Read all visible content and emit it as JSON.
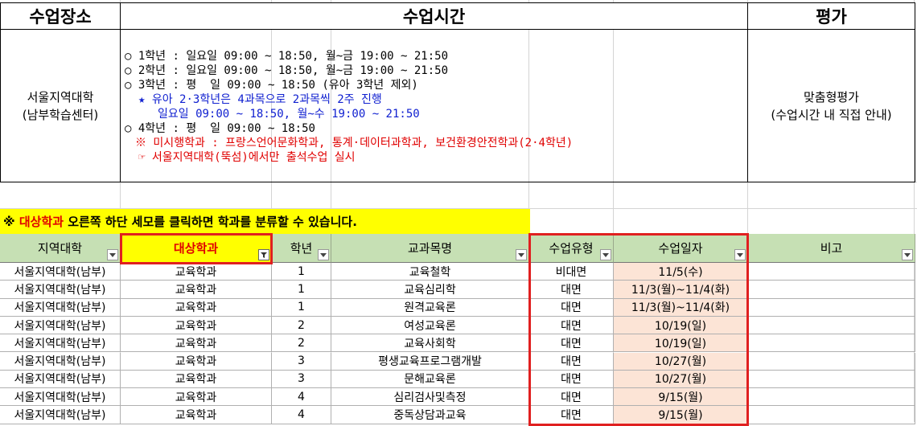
{
  "header": {
    "place": "수업장소",
    "time": "수업시간",
    "evaluation": "평가"
  },
  "location": {
    "line1": "서울지역대학",
    "line2": "(남부학습센터)"
  },
  "schedule": {
    "line1": "○ 1학년 : 일요일 09:00 ~ 18:50, 월~금 19:00 ~ 21:50",
    "line2": "○ 2학년 : 일요일 09:00 ~ 18:50, 월~금 19:00 ~ 21:50",
    "line3": "○ 3학년 : 평  일 09:00 ~ 18:50 (유아 3학년 제외)",
    "line4": "★ 유아 2·3학년은 4과목으로 2과목씩 2주 진행",
    "line5": "일요일 09:00 ~ 18:50, 월~수 19:00 ~ 21:50",
    "line6": "○ 4학년 : 평  일 09:00 ~ 18:50",
    "line7": "※ 미시행학과 : 프랑스언어문화학과, 통계·데이터과학과, 보건환경안전학과(2·4학년)",
    "line8": "☞ 서울지역대학(뚝섬)에서만 출석수업 실시"
  },
  "evaluation": {
    "line1": "맞춤형평가",
    "line2": "(수업시간 내 직접 안내)"
  },
  "notice": {
    "prefix": "※ ",
    "highlight": "대상학과",
    "rest": " 오른쪽 하단 세모를 클릭하면 학과를 분류할 수 있습니다."
  },
  "columns": [
    "지역대학",
    "대상학과",
    "학년",
    "교과목명",
    "수업유형",
    "수업일자",
    "비고"
  ],
  "rows": [
    [
      "서울지역대학(남부)",
      "교육학과",
      "1",
      "교육철학",
      "비대면",
      "11/5(수)",
      ""
    ],
    [
      "서울지역대학(남부)",
      "교육학과",
      "1",
      "교육심리학",
      "대면",
      "11/3(월)~11/4(화)",
      ""
    ],
    [
      "서울지역대학(남부)",
      "교육학과",
      "1",
      "원격교육론",
      "대면",
      "11/3(월)~11/4(화)",
      ""
    ],
    [
      "서울지역대학(남부)",
      "교육학과",
      "2",
      "여성교육론",
      "대면",
      "10/19(일)",
      ""
    ],
    [
      "서울지역대학(남부)",
      "교육학과",
      "2",
      "교육사회학",
      "대면",
      "10/19(일)",
      ""
    ],
    [
      "서울지역대학(남부)",
      "교육학과",
      "3",
      "평생교육프로그램개발",
      "대면",
      "10/27(월)",
      ""
    ],
    [
      "서울지역대학(남부)",
      "교육학과",
      "3",
      "문해교육론",
      "대면",
      "10/27(월)",
      ""
    ],
    [
      "서울지역대학(남부)",
      "교육학과",
      "4",
      "심리검사및측정",
      "대면",
      "9/15(월)",
      ""
    ],
    [
      "서울지역대학(남부)",
      "교육학과",
      "4",
      "중독상담과교육",
      "대면",
      "9/15(월)",
      ""
    ]
  ],
  "colors": {
    "header_green": "#c6e0b4",
    "highlight_yellow": "#ffff00",
    "date_peach": "#fce4d6",
    "frame_red": "#e02020"
  }
}
